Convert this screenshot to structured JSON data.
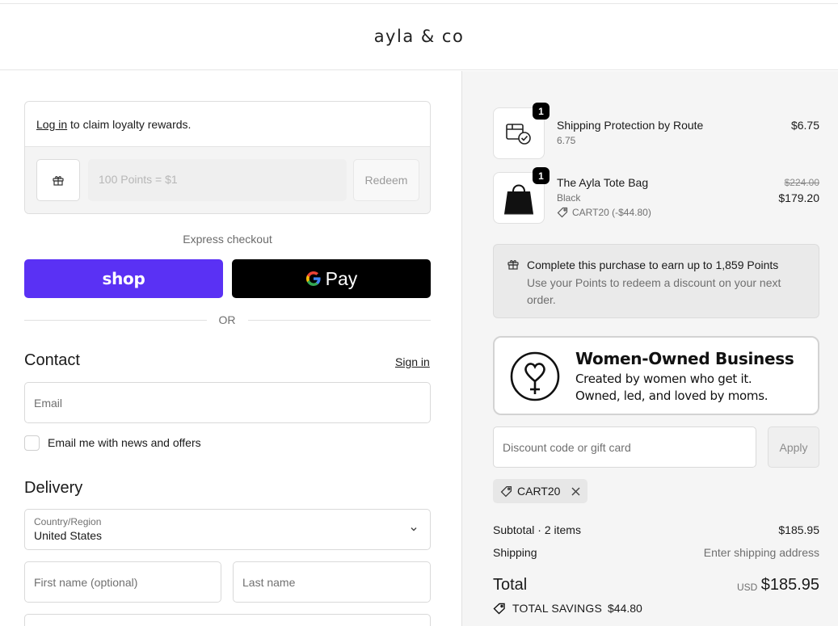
{
  "header": {
    "brand": "ayla & co"
  },
  "loyalty": {
    "login_link": "Log in",
    "login_text": " to claim loyalty rewards.",
    "points_placeholder": "100 Points = $1",
    "redeem_label": "Redeem"
  },
  "express": {
    "label": "Express checkout",
    "shop_label": "shop",
    "gpay_label": "Pay",
    "or_label": "OR"
  },
  "contact": {
    "title": "Contact",
    "sign_in": "Sign in",
    "email_placeholder": "Email",
    "newsletter_label": "Email me with news and offers"
  },
  "delivery": {
    "title": "Delivery",
    "country_label": "Country/Region",
    "country_value": "United States",
    "first_name_placeholder": "First name (optional)",
    "last_name_placeholder": "Last name"
  },
  "cart": {
    "items": [
      {
        "title": "Shipping Protection by Route",
        "subtitle": "6.75",
        "qty": "1",
        "price": "$6.75"
      },
      {
        "title": "The Ayla Tote Bag",
        "variant": "Black",
        "discount": "CART20 (-$44.80)",
        "qty": "1",
        "original_price": "$224.00",
        "price": "$179.20"
      }
    ],
    "earn": {
      "title": "Complete this purchase to earn up to 1,859 Points",
      "subtitle": "Use your Points to redeem a discount on your next order."
    },
    "banner": {
      "title": "Women-Owned Business",
      "line1": "Created by women who get it.",
      "line2": "Owned, led, and loved by moms."
    },
    "discount_placeholder": "Discount code or gift card",
    "apply_label": "Apply",
    "applied_code": "CART20",
    "summary": {
      "subtotal_label": "Subtotal · 2 items",
      "subtotal_value": "$185.95",
      "shipping_label": "Shipping",
      "shipping_value": "Enter shipping address",
      "total_label": "Total",
      "currency": "USD",
      "total_value": "$185.95",
      "savings_label": "TOTAL SAVINGS",
      "savings_value": "$44.80"
    }
  },
  "colors": {
    "shop_purple": "#5a31f4",
    "gpay_black": "#000000",
    "panel_bg": "#f5f5f5"
  }
}
